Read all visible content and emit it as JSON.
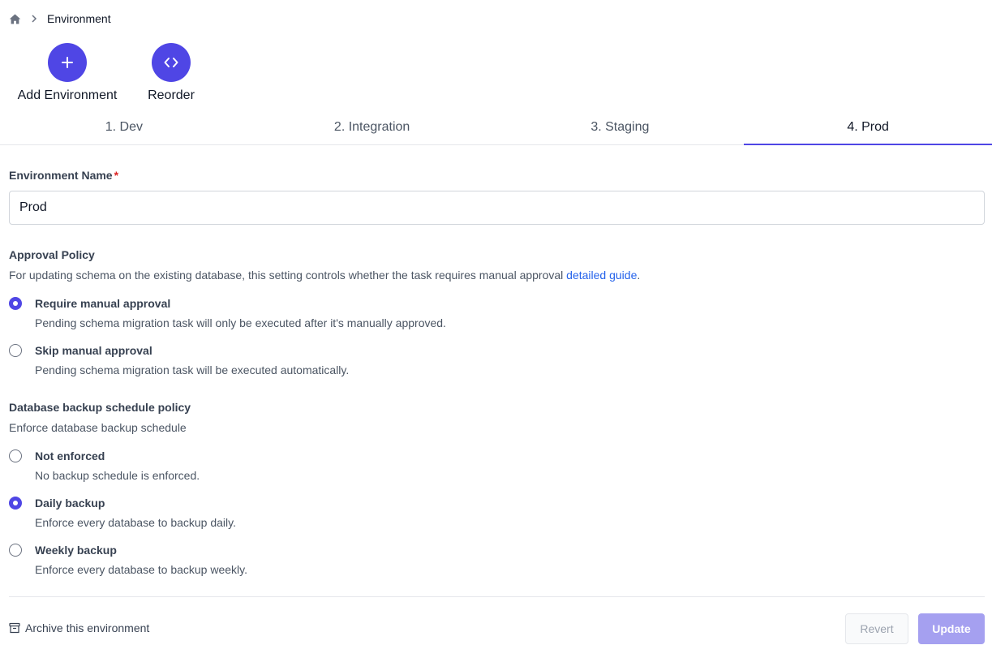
{
  "breadcrumb": {
    "current": "Environment"
  },
  "actions": {
    "add_label": "Add Environment",
    "reorder_label": "Reorder"
  },
  "tabs": [
    {
      "label": "1. Dev",
      "active": false
    },
    {
      "label": "2. Integration",
      "active": false
    },
    {
      "label": "3. Staging",
      "active": false
    },
    {
      "label": "4. Prod",
      "active": true
    }
  ],
  "form": {
    "name_label": "Environment Name",
    "required_mark": "*",
    "name_value": "Prod"
  },
  "approval": {
    "title": "Approval Policy",
    "desc": "For updating schema on the existing database, this setting controls whether the task requires manual approval ",
    "link": "detailed guide",
    "link_suffix": ".",
    "options": [
      {
        "title": "Require manual approval",
        "sub": "Pending schema migration task will only be executed after it's manually approved.",
        "checked": true
      },
      {
        "title": "Skip manual approval",
        "sub": "Pending schema migration task will be executed automatically.",
        "checked": false
      }
    ]
  },
  "backup": {
    "title": "Database backup schedule policy",
    "desc": "Enforce database backup schedule",
    "options": [
      {
        "title": "Not enforced",
        "sub": "No backup schedule is enforced.",
        "checked": false
      },
      {
        "title": "Daily backup",
        "sub": "Enforce every database to backup daily.",
        "checked": true
      },
      {
        "title": "Weekly backup",
        "sub": "Enforce every database to backup weekly.",
        "checked": false
      }
    ]
  },
  "footer": {
    "archive_label": "Archive this environment",
    "revert_label": "Revert",
    "update_label": "Update"
  },
  "colors": {
    "accent": "#4f46e5",
    "link": "#2563eb",
    "required": "#dc2626"
  }
}
